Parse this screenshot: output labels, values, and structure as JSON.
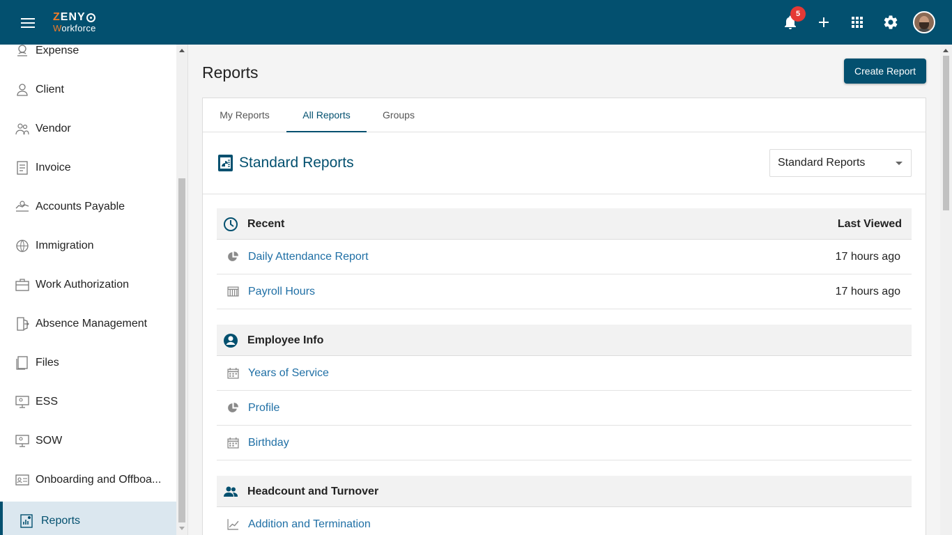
{
  "header": {
    "logo_top": "ZENY",
    "logo_bottom_w": "W",
    "logo_bottom_rest": "orkforce",
    "notification_count": "5",
    "icons": [
      "menu-icon",
      "bell-icon",
      "plus-icon",
      "apps-grid-icon",
      "gear-icon",
      "avatar"
    ],
    "brand_color": "#03506f",
    "accent_color": "#f07c29"
  },
  "sidebar": {
    "items": [
      {
        "label": "Expense",
        "icon": "expense-icon"
      },
      {
        "label": "Client",
        "icon": "client-icon"
      },
      {
        "label": "Vendor",
        "icon": "vendor-icon"
      },
      {
        "label": "Invoice",
        "icon": "invoice-icon"
      },
      {
        "label": "Accounts Payable",
        "icon": "accounts-payable-icon"
      },
      {
        "label": "Immigration",
        "icon": "immigration-icon"
      },
      {
        "label": "Work Authorization",
        "icon": "work-authorization-icon"
      },
      {
        "label": "Absence Management",
        "icon": "absence-icon"
      },
      {
        "label": "Files",
        "icon": "files-icon"
      },
      {
        "label": "ESS",
        "icon": "ess-icon"
      },
      {
        "label": "SOW",
        "icon": "sow-icon"
      },
      {
        "label": "Onboarding and Offboa...",
        "icon": "onboarding-icon"
      },
      {
        "label": "Reports",
        "icon": "reports-icon",
        "active": true
      }
    ]
  },
  "main": {
    "title": "Reports",
    "create_button": "Create Report",
    "tabs": [
      {
        "label": "My Reports"
      },
      {
        "label": "All Reports",
        "active": true
      },
      {
        "label": "Groups"
      }
    ],
    "section_title": "Standard Reports",
    "select_value": "Standard Reports",
    "groups": [
      {
        "title": "Recent",
        "right_label": "Last Viewed",
        "icon": "clock-icon",
        "rows": [
          {
            "label": "Daily Attendance Report",
            "time": "17 hours ago",
            "icon": "pie-chart-icon"
          },
          {
            "label": "Payroll Hours",
            "time": "17 hours ago",
            "icon": "table-icon"
          }
        ]
      },
      {
        "title": "Employee Info",
        "icon": "person-circle-icon",
        "rows": [
          {
            "label": "Years of Service",
            "icon": "calendar-icon"
          },
          {
            "label": "Profile",
            "icon": "pie-chart-icon"
          },
          {
            "label": "Birthday",
            "icon": "calendar-icon"
          }
        ]
      },
      {
        "title": "Headcount and Turnover",
        "icon": "people-icon",
        "rows": [
          {
            "label": "Addition and Termination",
            "icon": "trending-up-icon"
          }
        ]
      }
    ]
  }
}
